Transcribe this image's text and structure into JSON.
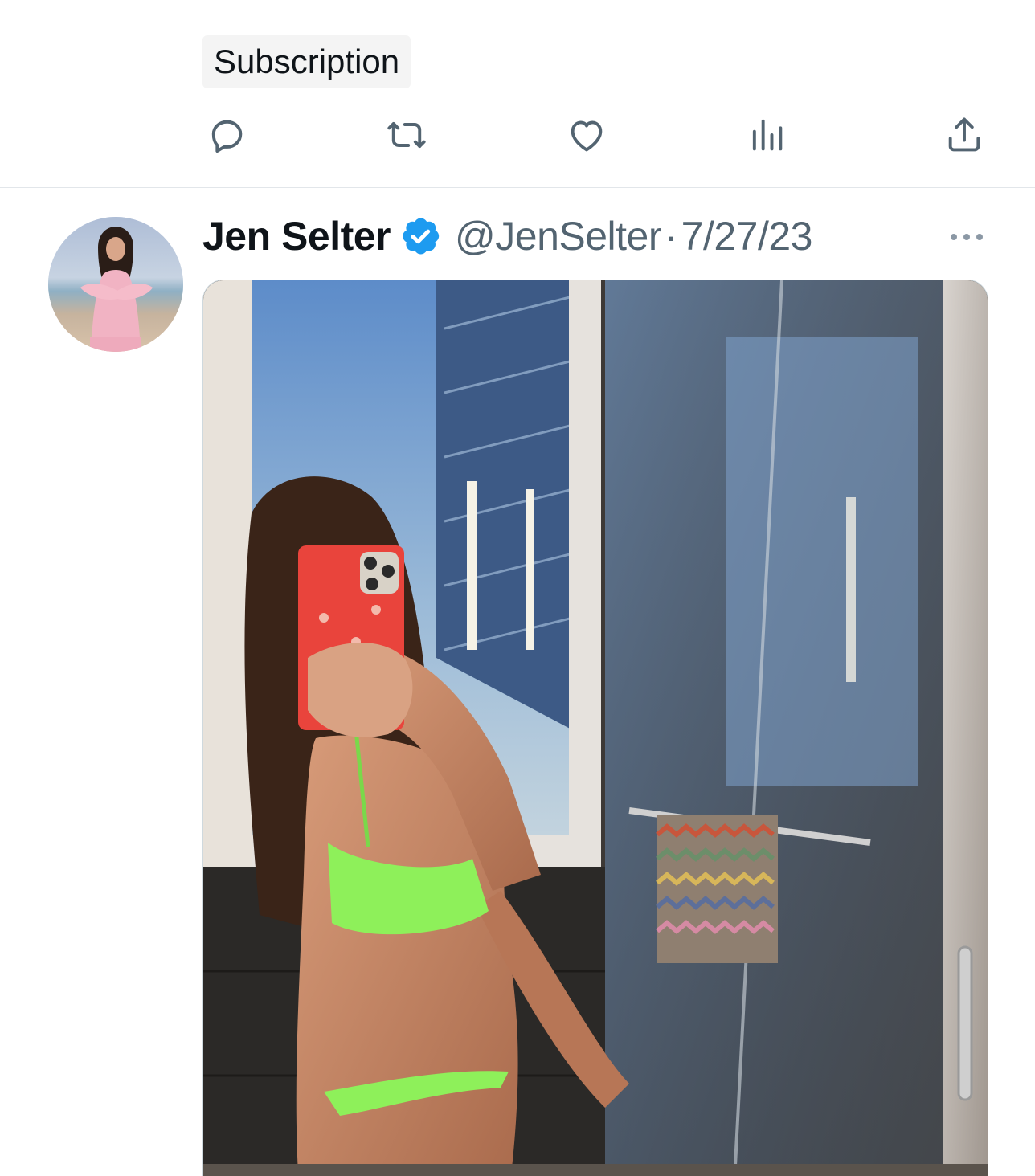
{
  "previous_tweet": {
    "chip_label": "Subscription",
    "actions": [
      {
        "name": "reply",
        "icon": "reply-icon"
      },
      {
        "name": "repost",
        "icon": "repost-icon"
      },
      {
        "name": "like",
        "icon": "heart-icon"
      },
      {
        "name": "views",
        "icon": "bar-chart-icon"
      },
      {
        "name": "share",
        "icon": "share-icon"
      }
    ]
  },
  "tweet": {
    "display_name": "Jen Selter",
    "verified": true,
    "handle": "@JenSelter",
    "separator": "·",
    "date": "7/27/23",
    "more_icon": "more-icon",
    "media": {
      "kind": "photo",
      "description_icon": "photo"
    }
  },
  "colors": {
    "text_primary": "#0f1419",
    "text_secondary": "#536471",
    "verified_blue": "#1d9bf0",
    "divider": "#e2e6ea",
    "chip_bg": "#f4f4f4"
  }
}
